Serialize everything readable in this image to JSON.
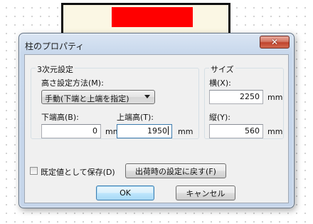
{
  "dialog": {
    "title": "柱のプロパティ",
    "close_glyph": "✕"
  },
  "group3d": {
    "legend": "3次元設定",
    "height_method_label": "高さ設定方法(M):",
    "height_method_value": "手動(下端と上端を指定)",
    "bottom_label": "下端高(B):",
    "bottom_value": "0",
    "bottom_unit": "mm",
    "top_label": "上端高(T):",
    "top_value": "1950",
    "top_unit": "mm"
  },
  "size": {
    "legend": "サイズ",
    "width_label": "横(X):",
    "width_value": "2250",
    "width_unit": "mm",
    "depth_label": "縦(Y):",
    "depth_value": "560",
    "depth_unit": "mm"
  },
  "footer": {
    "save_default_label": "既定値として保存(D)",
    "save_default_checked": false,
    "reset_label": "出荷時の設定に戻す(F)",
    "ok_label": "OK",
    "cancel_label": "キャンセル"
  }
}
